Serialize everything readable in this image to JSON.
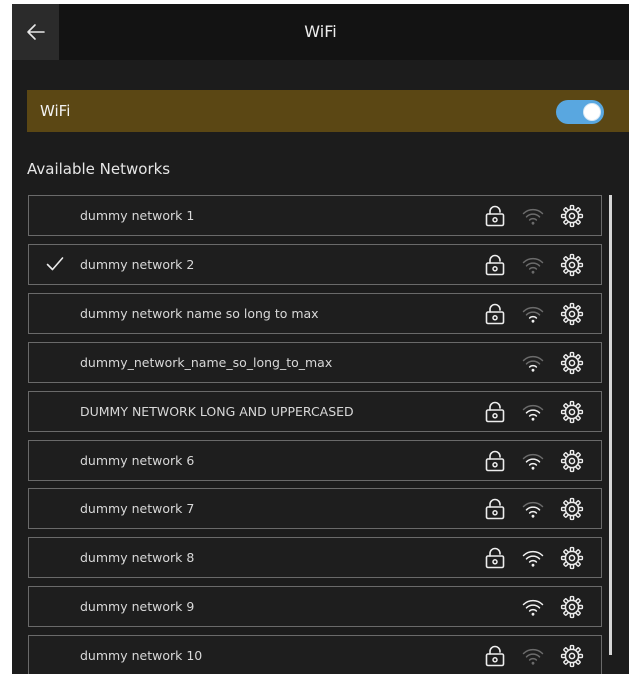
{
  "header": {
    "title": "WiFi",
    "back_icon": "arrow-left-icon"
  },
  "wifi_toggle": {
    "label": "WiFi",
    "on": true,
    "color_on": "#59a7e0",
    "row_color": "#5b4714"
  },
  "networks_section": {
    "title": "Available Networks"
  },
  "networks": [
    {
      "name": "dummy network 1",
      "connected": false,
      "secured": true,
      "signal": 0
    },
    {
      "name": "dummy network 2",
      "connected": true,
      "secured": true,
      "signal": 0
    },
    {
      "name": "dummy network name so long to max",
      "connected": false,
      "secured": true,
      "signal": 1
    },
    {
      "name": "dummy_network_name_so_long_to_max",
      "connected": false,
      "secured": false,
      "signal": 1
    },
    {
      "name": "DUMMY NETWORK LONG AND UPPERCASED",
      "connected": false,
      "secured": true,
      "signal": 2
    },
    {
      "name": "dummy network 6",
      "connected": false,
      "secured": true,
      "signal": 2
    },
    {
      "name": "dummy network 7",
      "connected": false,
      "secured": true,
      "signal": 2
    },
    {
      "name": "dummy network 8",
      "connected": false,
      "secured": true,
      "signal": 3
    },
    {
      "name": "dummy network 9",
      "connected": false,
      "secured": false,
      "signal": 3
    },
    {
      "name": "dummy network 10",
      "connected": false,
      "secured": true,
      "signal": 0
    }
  ],
  "icons": {
    "connected": "checkmark-icon",
    "secured": "lock-icon",
    "signal": "wifi-signal-icon",
    "settings": "gear-icon"
  }
}
